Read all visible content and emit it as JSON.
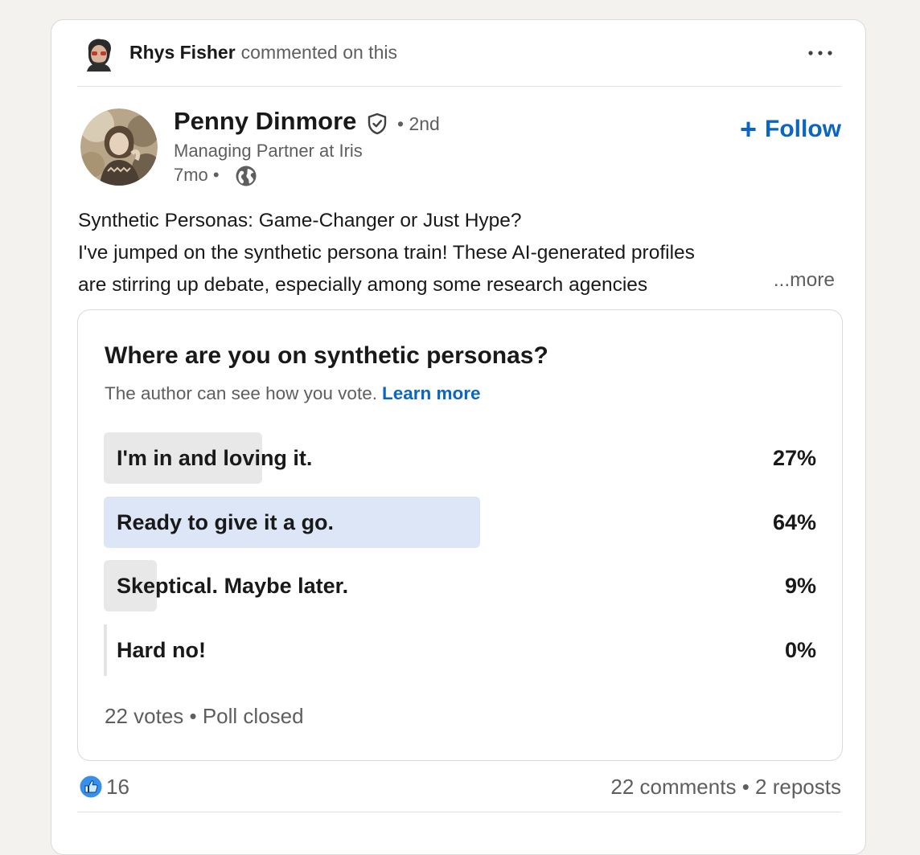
{
  "activity": {
    "actor": "Rhys Fisher",
    "action": "commented on this"
  },
  "author": {
    "name": "Penny Dinmore",
    "degree": "• 2nd",
    "headline": "Managing Partner at Iris",
    "time": "7mo •",
    "follow_label": "Follow"
  },
  "post": {
    "line1": "Synthetic Personas: Game-Changer or Just Hype?",
    "line2": "I've jumped on the synthetic persona train! These AI-generated profiles",
    "line3": "are stirring up debate, especially among some research agencies",
    "see_more": "...more"
  },
  "poll": {
    "question": "Where are you on synthetic personas?",
    "note": "The author can see how you vote.",
    "learn_more": "Learn more",
    "options": [
      {
        "label": "I'm in and loving it.",
        "percent_text": "27%",
        "percent": 27
      },
      {
        "label": "Ready to give it a go.",
        "percent_text": "64%",
        "percent": 64
      },
      {
        "label": "Skeptical. Maybe later.",
        "percent_text": "9%",
        "percent": 9
      },
      {
        "label": "Hard no!",
        "percent_text": "0%",
        "percent": 0
      }
    ],
    "footer": "22 votes • Poll closed"
  },
  "social": {
    "reactions": "16",
    "comments": "22 comments",
    "separator": "•",
    "reposts": "2 reposts"
  },
  "colors": {
    "accent": "#0a66c2",
    "winning_bar": "#dce6f7",
    "bar": "#e8e8e8"
  }
}
